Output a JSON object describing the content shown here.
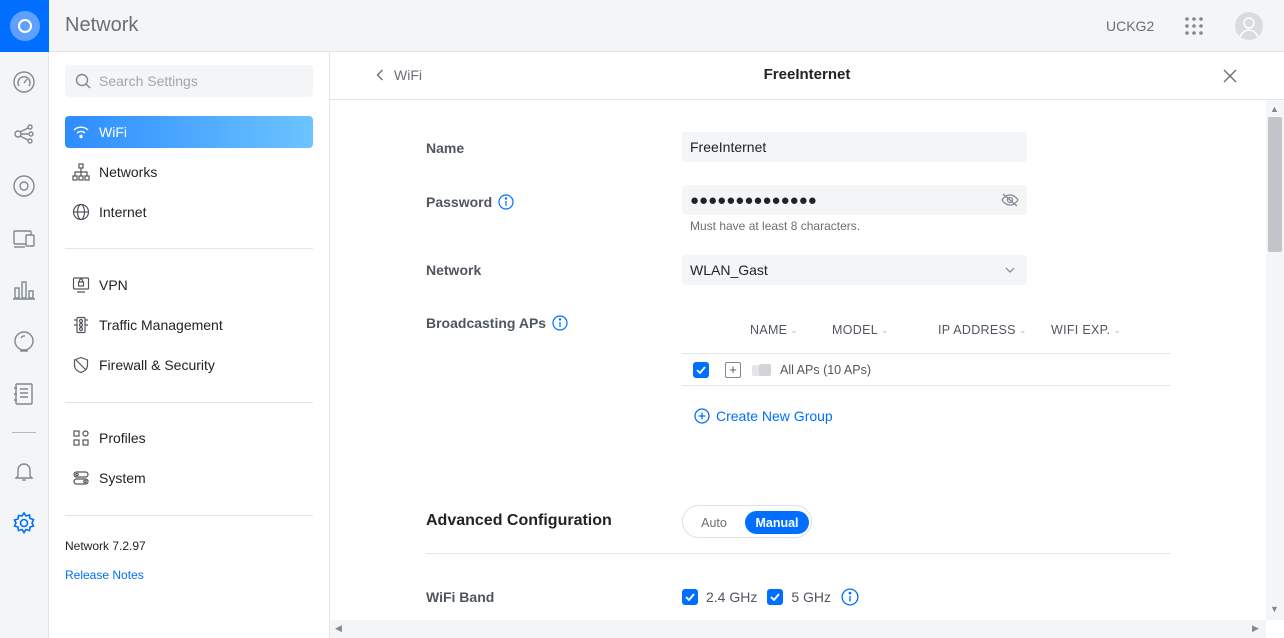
{
  "app": {
    "title": "Network",
    "device": "UCKG2"
  },
  "topbar": {
    "apps_icon": "grid-icon",
    "avatar_icon": "user-avatar-icon"
  },
  "rail": {
    "items": [
      "dashboard-icon",
      "topology-icon",
      "devices-icon",
      "clients-icon",
      "statistics-icon",
      "insights-icon",
      "logs-icon",
      "notifications-icon",
      "settings-icon"
    ]
  },
  "sidebar": {
    "search_placeholder": "Search Settings",
    "items": [
      {
        "label": "WiFi",
        "icon": "wifi-icon",
        "active": true
      },
      {
        "label": "Networks",
        "icon": "networks-icon"
      },
      {
        "label": "Internet",
        "icon": "globe-icon"
      },
      {
        "label": "VPN",
        "icon": "vpn-icon"
      },
      {
        "label": "Traffic Management",
        "icon": "traffic-icon"
      },
      {
        "label": "Firewall & Security",
        "icon": "shield-icon"
      },
      {
        "label": "Profiles",
        "icon": "profiles-icon"
      },
      {
        "label": "System",
        "icon": "system-icon"
      }
    ],
    "version": "Network 7.2.97",
    "release_notes": "Release Notes"
  },
  "panel": {
    "back_label": "WiFi",
    "title": "FreeInternet",
    "name_label": "Name",
    "name_value": "FreeInternet",
    "password_label": "Password",
    "password_value": "●●●●●●●●●●●●●●",
    "password_hint": "Must have at least 8 characters.",
    "network_label": "Network",
    "network_value": "WLAN_Gast",
    "broadcasting_label": "Broadcasting APs",
    "ap_columns": [
      "NAME",
      "MODEL",
      "IP ADDRESS",
      "WIFI EXP."
    ],
    "ap_row": {
      "label": "All APs (10 APs)",
      "checked": true
    },
    "create_group": "Create New Group",
    "advanced_title": "Advanced Configuration",
    "mode_options": {
      "auto": "Auto",
      "manual": "Manual",
      "selected": "Manual"
    },
    "band_label": "WiFi Band",
    "bands": [
      {
        "label": "2.4 GHz",
        "checked": true
      },
      {
        "label": "5 GHz",
        "checked": true
      }
    ]
  },
  "colors": {
    "accent": "#006fff",
    "active_gradient_start": "#2d8cff",
    "active_gradient_end": "#6cc4ff"
  }
}
